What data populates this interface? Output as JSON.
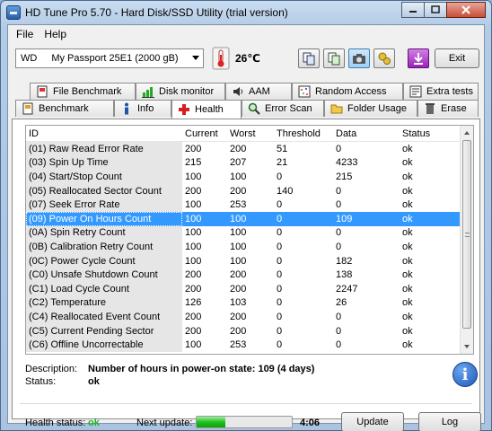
{
  "window": {
    "title": "HD Tune Pro 5.70 - Hard Disk/SSD Utility (trial version)",
    "caption_buttons": [
      "minimize-icon",
      "maximize-icon",
      "close-icon"
    ]
  },
  "menu": {
    "file": "File",
    "help": "Help"
  },
  "toolbar": {
    "drive_brand": "WD",
    "drive_model": "My Passport 25E1 (2000 gB)",
    "temperature": "26℃",
    "exit_label": "Exit",
    "buttons": [
      "copy-info-icon",
      "copy-text-icon",
      "screenshot-icon",
      "options-icon",
      "save-download-icon"
    ]
  },
  "tabs": {
    "row_back": [
      {
        "label": "File Benchmark",
        "icon": "file-benchmark-icon"
      },
      {
        "label": "Disk monitor",
        "icon": "disk-monitor-icon"
      },
      {
        "label": "AAM",
        "icon": "speaker-icon"
      },
      {
        "label": "Random Access",
        "icon": "random-access-icon"
      },
      {
        "label": "Extra tests",
        "icon": "extra-tests-icon"
      }
    ],
    "row_front": [
      {
        "label": "Benchmark",
        "icon": "benchmark-icon"
      },
      {
        "label": "Info",
        "icon": "info-tab-icon"
      },
      {
        "label": "Health",
        "icon": "health-cross-icon"
      },
      {
        "label": "Error Scan",
        "icon": "magnifier-icon"
      },
      {
        "label": "Folder Usage",
        "icon": "folder-icon"
      },
      {
        "label": "Erase",
        "icon": "trash-icon"
      }
    ]
  },
  "table": {
    "headers": [
      "ID",
      "Current",
      "Worst",
      "Threshold",
      "Data",
      "Status"
    ],
    "rows": [
      [
        "(01) Raw Read Error Rate",
        "200",
        "200",
        "51",
        "0",
        "ok"
      ],
      [
        "(03) Spin Up Time",
        "215",
        "207",
        "21",
        "4233",
        "ok"
      ],
      [
        "(04) Start/Stop Count",
        "100",
        "100",
        "0",
        "215",
        "ok"
      ],
      [
        "(05) Reallocated Sector Count",
        "200",
        "200",
        "140",
        "0",
        "ok"
      ],
      [
        "(07) Seek Error Rate",
        "100",
        "253",
        "0",
        "0",
        "ok"
      ],
      [
        "(09) Power On Hours Count",
        "100",
        "100",
        "0",
        "109",
        "ok"
      ],
      [
        "(0A) Spin Retry Count",
        "100",
        "100",
        "0",
        "0",
        "ok"
      ],
      [
        "(0B) Calibration Retry Count",
        "100",
        "100",
        "0",
        "0",
        "ok"
      ],
      [
        "(0C) Power Cycle Count",
        "100",
        "100",
        "0",
        "182",
        "ok"
      ],
      [
        "(C0) Unsafe Shutdown Count",
        "200",
        "200",
        "0",
        "138",
        "ok"
      ],
      [
        "(C1) Load Cycle Count",
        "200",
        "200",
        "0",
        "2247",
        "ok"
      ],
      [
        "(C2) Temperature",
        "126",
        "103",
        "0",
        "26",
        "ok"
      ],
      [
        "(C4) Reallocated Event Count",
        "200",
        "200",
        "0",
        "0",
        "ok"
      ],
      [
        "(C5) Current Pending Sector",
        "200",
        "200",
        "0",
        "0",
        "ok"
      ],
      [
        "(C6) Offline Uncorrectable",
        "100",
        "253",
        "0",
        "0",
        "ok"
      ]
    ],
    "selected_index": 5
  },
  "details": {
    "description_label": "Description:",
    "description_value": "Number of hours in power-on state: 109 (4 days)",
    "status_label": "Status:",
    "status_value": "ok"
  },
  "footer": {
    "health_label": "Health status:",
    "health_value": "ok",
    "health_color": "#22b022",
    "next_update_label": "Next update:",
    "progress_fraction": 0.3,
    "next_update_time": "4:06",
    "update_label": "Update",
    "log_label": "Log"
  }
}
